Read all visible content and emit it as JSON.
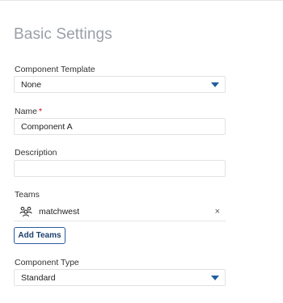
{
  "heading": "Basic Settings",
  "component_template": {
    "label": "Component Template",
    "value": "None",
    "icon": "caret-down-icon"
  },
  "name": {
    "label": "Name",
    "required_marker": "*",
    "value": "Component A"
  },
  "description": {
    "label": "Description",
    "value": ""
  },
  "teams": {
    "label": "Teams",
    "items": [
      {
        "name": "matchwest",
        "icon": "team-group-icon",
        "remove_symbol": "×"
      }
    ],
    "add_button": "Add Teams"
  },
  "component_type": {
    "label": "Component Type",
    "value": "Standard",
    "icon": "caret-down-icon"
  },
  "colors": {
    "accent": "#1f5fa0",
    "required": "#d0021b",
    "heading": "#9aa0a6"
  }
}
